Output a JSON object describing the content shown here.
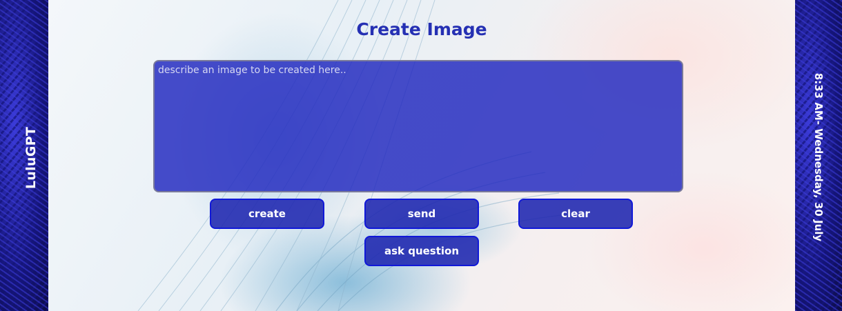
{
  "sidebar": {
    "brand": "LuluGPT"
  },
  "status": {
    "datetime": "8:33 AM- Wednesday, 30 July"
  },
  "main": {
    "title": "Create Image",
    "prompt_placeholder": "describe an image to be created here..",
    "prompt_value": ""
  },
  "buttons": {
    "create": "create",
    "send": "send",
    "clear": "clear",
    "ask_question": "ask question"
  },
  "colors": {
    "accent": "#1e26be",
    "title": "#2530b3",
    "button_border": "#1018d8",
    "side_panel": "#1a1a6e"
  }
}
